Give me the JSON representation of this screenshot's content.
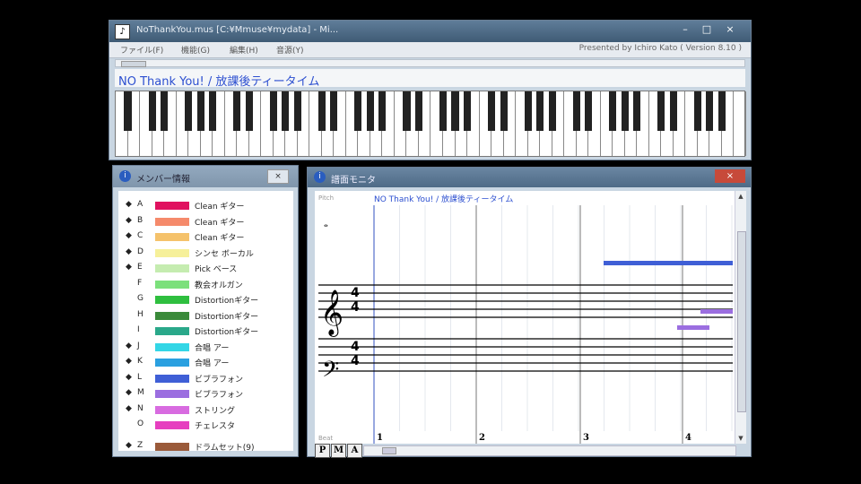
{
  "main_window": {
    "title": "NoThankYou.mus [C:¥Mmuse¥mydata] - Mi...",
    "menu": [
      "ファイル(F)",
      "機能(G)",
      "編集(H)",
      "音源(Y)"
    ],
    "credit": "Presented by Ichiro Kato ( Version 8.10 )",
    "song_title": "NO Thank You! / 放課後ティータイム",
    "controls": {
      "minimize": "–",
      "maximize": "□",
      "close": "×"
    }
  },
  "member_window": {
    "title": "メンバー情報",
    "close_label": "×",
    "members": [
      {
        "letter": "A",
        "bullet": true,
        "color": "#e0115f",
        "instrument": "Clean ギター"
      },
      {
        "letter": "B",
        "bullet": true,
        "color": "#f58a6b",
        "instrument": "Clean ギター"
      },
      {
        "letter": "C",
        "bullet": true,
        "color": "#f5c26b",
        "instrument": "Clean ギター"
      },
      {
        "letter": "D",
        "bullet": true,
        "color": "#f6f09a",
        "instrument": "シンセ ボーカル"
      },
      {
        "letter": "E",
        "bullet": true,
        "color": "#c5ecb0",
        "instrument": "Pick ベース"
      },
      {
        "letter": "F",
        "bullet": false,
        "color": "#7be07b",
        "instrument": "教会オルガン"
      },
      {
        "letter": "G",
        "bullet": false,
        "color": "#2fbf3f",
        "instrument": "Distortionギター"
      },
      {
        "letter": "H",
        "bullet": false,
        "color": "#3a8a3a",
        "instrument": "Distortionギター"
      },
      {
        "letter": "I",
        "bullet": false,
        "color": "#2aa88a",
        "instrument": "Distortionギター"
      },
      {
        "letter": "J",
        "bullet": true,
        "color": "#33d6e6",
        "instrument": "合唱 アー"
      },
      {
        "letter": "K",
        "bullet": true,
        "color": "#2aa0e0",
        "instrument": "合唱 アー"
      },
      {
        "letter": "L",
        "bullet": true,
        "color": "#3f5fd6",
        "instrument": "ビブラフォン"
      },
      {
        "letter": "M",
        "bullet": true,
        "color": "#9b6ee0",
        "instrument": "ビブラフォン"
      },
      {
        "letter": "N",
        "bullet": true,
        "color": "#d86be0",
        "instrument": "ストリング"
      },
      {
        "letter": "O",
        "bullet": false,
        "color": "#e63fbf",
        "instrument": "チェレスタ"
      },
      {
        "letter": "Z",
        "bullet": true,
        "color": "#9a5a3a",
        "instrument": "ドラムセット(9)"
      }
    ]
  },
  "score_window": {
    "title": "譜面モニタ",
    "close_label": "×",
    "song_title": "NO Thank You! / 放課後ティータイム",
    "top_label": "Pitch",
    "bottom_label": "Beat",
    "time_signature": "4/4",
    "measures": [
      "1",
      "2",
      "3",
      "4"
    ],
    "buttons": [
      "P",
      "M",
      "A"
    ]
  },
  "colors": {
    "accent": "#2c4fd0",
    "note_blue": "#3f5fd6",
    "note_purple": "#9b6ee0"
  }
}
